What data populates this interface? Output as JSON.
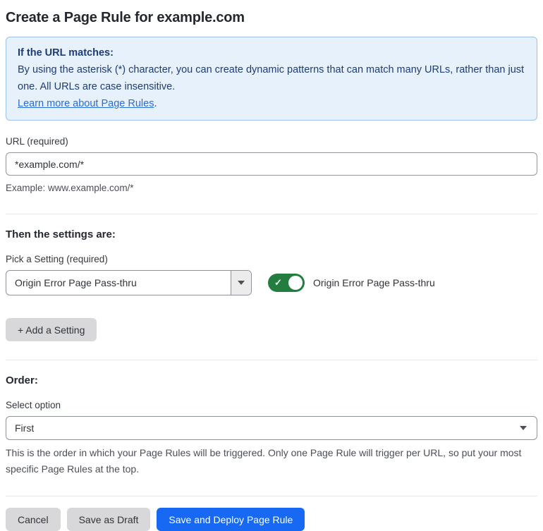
{
  "page": {
    "title": "Create a Page Rule for example.com"
  },
  "info_box": {
    "heading": "If the URL matches:",
    "body": "By using the asterisk (*) character, you can create dynamic patterns that can match many URLs, rather than just one. All URLs are case insensitive.",
    "link_label": "Learn more about Page Rules",
    "link_suffix": "."
  },
  "url_field": {
    "label": "URL (required)",
    "value": "*example.com/*",
    "example": "Example: www.example.com/*"
  },
  "settings_section": {
    "heading": "Then the settings are:",
    "picker_label": "Pick a Setting (required)",
    "picker_value": "Origin Error Page Pass-thru",
    "toggle_state": "on",
    "toggle_check_glyph": "✓",
    "toggle_label": "Origin Error Page Pass-thru",
    "add_setting_label": "+ Add a Setting"
  },
  "order_section": {
    "heading": "Order:",
    "select_label": "Select option",
    "select_value": "First",
    "help_text": "This is the order in which your Page Rules will be triggered. Only one Page Rule will trigger per URL, so put your most specific Page Rules at the top."
  },
  "footer": {
    "cancel_label": "Cancel",
    "save_draft_label": "Save as Draft",
    "save_deploy_label": "Save and Deploy Page Rule"
  },
  "colors": {
    "accent_blue": "#1768f2",
    "toggle_green": "#237d3f",
    "info_background": "#e7f1fc",
    "info_border": "#9dc1e8",
    "info_text": "#1e3c74",
    "link_blue": "#2b6bd8"
  }
}
